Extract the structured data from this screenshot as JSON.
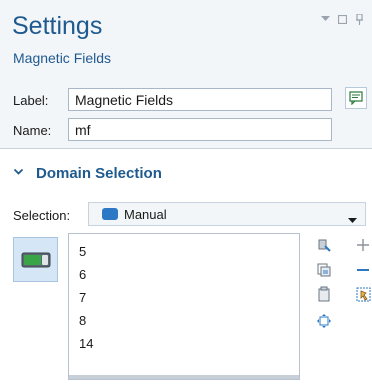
{
  "header": {
    "title": "Settings",
    "subtitle": "Magnetic Fields"
  },
  "window_controls": [
    "dropdown-arrow-icon",
    "restore-icon",
    "pin-icon"
  ],
  "fields": {
    "label": {
      "caption": "Label:",
      "value": "Magnetic Fields"
    },
    "name": {
      "caption": "Name:",
      "value": "mf"
    }
  },
  "section": {
    "title": "Domain Selection",
    "expanded": true
  },
  "selection": {
    "caption": "Selection:",
    "value": "Manual",
    "icon_color": "#2d78c4"
  },
  "domains": [
    "5",
    "6",
    "7",
    "8",
    "14"
  ],
  "toolbar_icons": [
    "paste-selection-icon",
    "add-icon",
    "copy-selection-icon",
    "remove-icon",
    "clear-selection-icon",
    "zoom-to-selection-icon",
    "move-icon"
  ],
  "colors": {
    "accent": "#1f5a8f",
    "header_bg": "#f3f6f9",
    "toggle_bg": "#d5e6f7",
    "toggle_green": "#3aa547"
  }
}
